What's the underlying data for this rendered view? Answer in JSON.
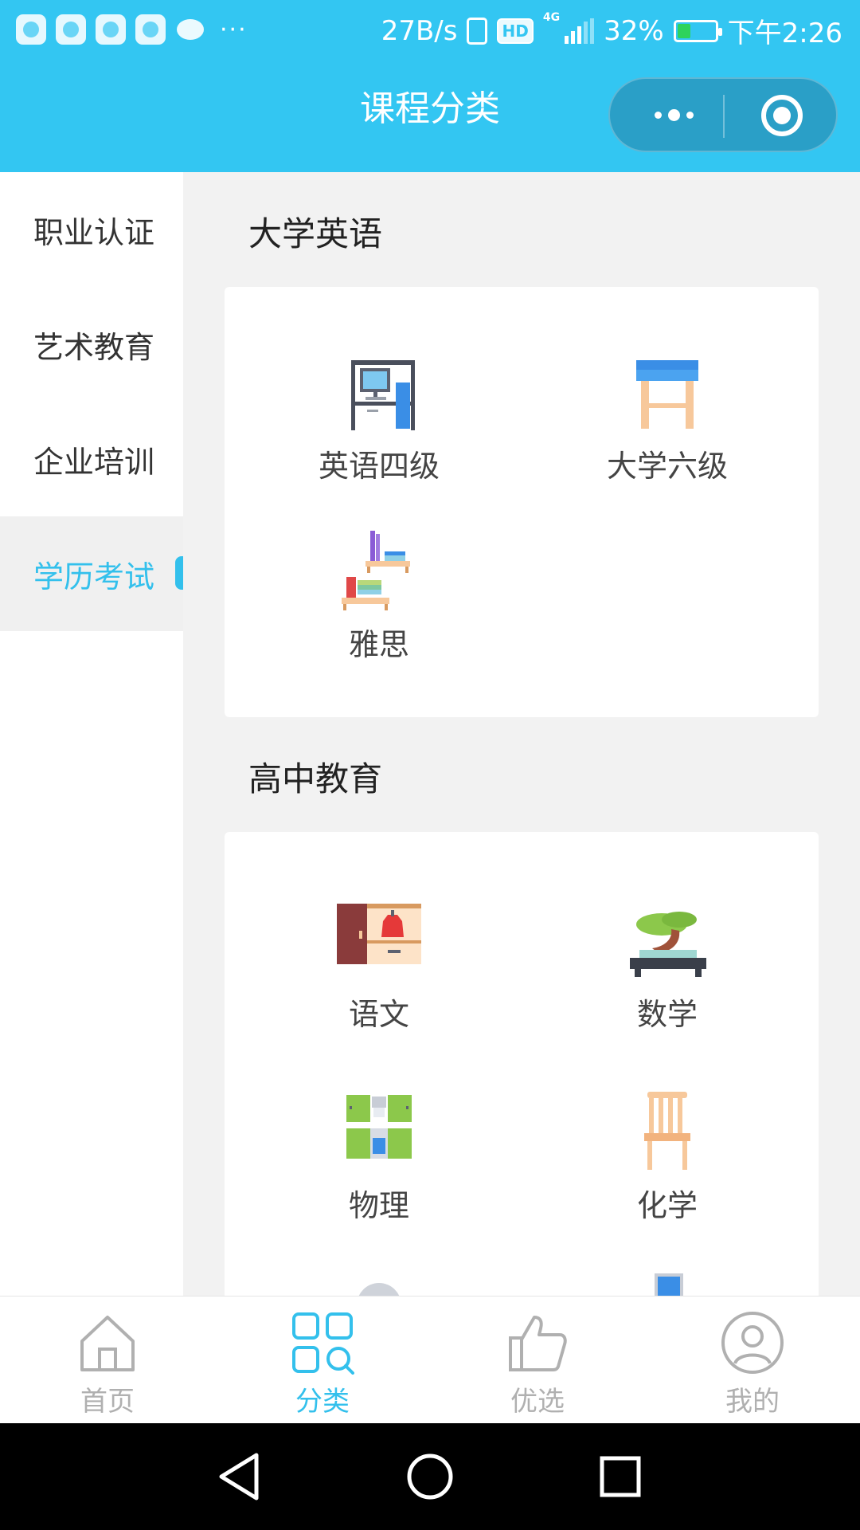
{
  "status_bar": {
    "speed": "27B/s",
    "hd": "HD",
    "network": "4G",
    "battery": "32%",
    "time": "下午2:26",
    "more": "···",
    "app_icons": [
      "baidu-icon",
      "telegram-icon",
      "play-icon",
      "camera-icon",
      "chat-icon"
    ]
  },
  "header": {
    "title": "课程分类",
    "more_icon": "more-dots-icon",
    "close_icon": "close-target-icon"
  },
  "sidebar": {
    "items": [
      {
        "label": "职业认证"
      },
      {
        "label": "艺术教育"
      },
      {
        "label": "企业培训"
      },
      {
        "label": "学历考试",
        "active": true
      }
    ]
  },
  "sections": [
    {
      "title": "大学英语",
      "items": [
        {
          "label": "英语四级",
          "icon": "computer-desk-icon"
        },
        {
          "label": "大学六级",
          "icon": "stool-icon"
        },
        {
          "label": "雅思",
          "icon": "bookshelf-icon"
        }
      ]
    },
    {
      "title": "高中教育",
      "items": [
        {
          "label": "语文",
          "icon": "wardrobe-icon"
        },
        {
          "label": "数学",
          "icon": "bonsai-icon"
        },
        {
          "label": "物理",
          "icon": "kitchen-cabinet-icon"
        },
        {
          "label": "化学",
          "icon": "chair-icon"
        }
      ]
    }
  ],
  "tabbar": {
    "tabs": [
      {
        "label": "首页",
        "icon": "home-icon"
      },
      {
        "label": "分类",
        "icon": "category-icon",
        "active": true
      },
      {
        "label": "优选",
        "icon": "thumbs-up-icon"
      },
      {
        "label": "我的",
        "icon": "user-icon"
      }
    ]
  },
  "colors": {
    "accent": "#33c6f2",
    "active_text": "#33c0ec",
    "inactive_tab": "#b0b0b0"
  }
}
